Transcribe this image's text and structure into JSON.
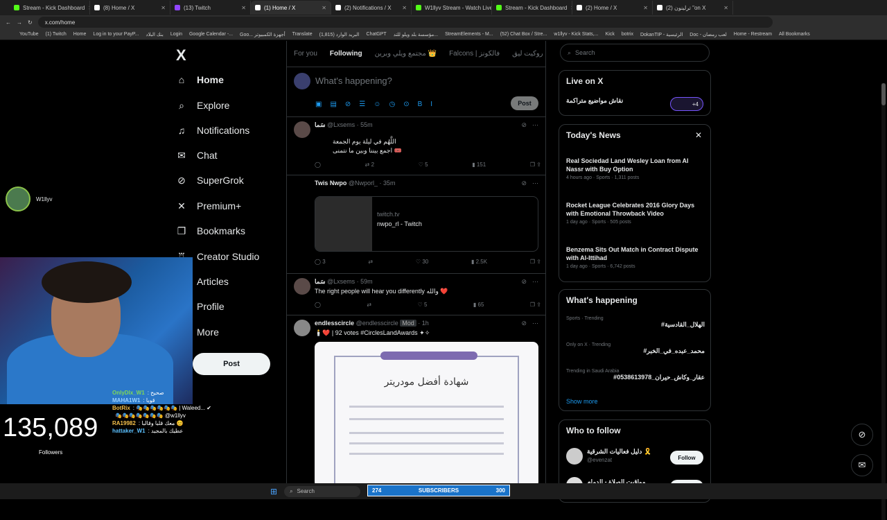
{
  "browser": {
    "tabs": [
      {
        "label": "Stream - Kick Dashboard",
        "color": "#53fc18"
      },
      {
        "label": "(8) Home / X",
        "color": "#ffffff"
      },
      {
        "label": "(13) Twitch",
        "color": "#9146ff"
      },
      {
        "label": "(1) Home / X",
        "color": "#ffffff"
      },
      {
        "label": "(2) Notifications / X",
        "color": "#ffffff"
      },
      {
        "label": "W1llyv Stream - Watch Live o",
        "color": "#53fc18"
      },
      {
        "label": "Stream - Kick Dashboard",
        "color": "#53fc18"
      },
      {
        "label": "(2) Home / X",
        "color": "#ffffff"
      },
      {
        "label": "(2) ترلينون \"on X",
        "color": "#ffffff"
      }
    ],
    "active_tab": 3,
    "url": "x.com/home",
    "bookmarks": [
      "YouTube",
      "(1) Twitch",
      "Home",
      "Log in to your PayP...",
      "بنك البلاد",
      "Login",
      "Google Calendar -...",
      "Goo... أجهزة الكمبيوتر",
      "Translate",
      "البريد الوارد (1,815)",
      "ChatGPT",
      "مؤسسة بلد ويلو للتد...",
      "StreamElements - M...",
      "(52) Chat Box / Stre...",
      "w1llyv - Kick Stats,...",
      "Kick",
      "botrix",
      "DokanTIP - الرئيسية",
      "Doc - لعب رمضان",
      "Home - Restream",
      "All Bookmarks"
    ]
  },
  "nav": {
    "logo": "X",
    "items": [
      {
        "label": "Home",
        "icon": "home-icon",
        "glyph": "⌂"
      },
      {
        "label": "Explore",
        "icon": "search-icon",
        "glyph": "⌕"
      },
      {
        "label": "Notifications",
        "icon": "bell-icon",
        "glyph": "♫"
      },
      {
        "label": "Chat",
        "icon": "mail-icon",
        "glyph": "✉"
      },
      {
        "label": "SuperGrok",
        "icon": "grok-icon",
        "glyph": "⊘"
      },
      {
        "label": "Premium+",
        "icon": "x-premium-icon",
        "glyph": "✕"
      },
      {
        "label": "Bookmarks",
        "icon": "bookmark-icon",
        "glyph": "❐"
      },
      {
        "label": "Creator Studio",
        "icon": "creator-icon",
        "glyph": "♖"
      },
      {
        "label": "Articles",
        "icon": "articles-icon",
        "glyph": "▤"
      },
      {
        "label": "Profile",
        "icon": "profile-icon",
        "glyph": "☺"
      },
      {
        "label": "More",
        "icon": "more-icon",
        "glyph": "⋯"
      }
    ],
    "post_label": "Post"
  },
  "feed": {
    "tabs": [
      "For you",
      "Following",
      "مجتمع ويلي وبرين 👑",
      "Falcons | فالكونز",
      "روكيت ليق"
    ],
    "compose_placeholder": "What's happening?",
    "compose_post": "Post",
    "tweets": [
      {
        "name": "سَما",
        "handle": "@Lxsems",
        "time": "55m",
        "text1": "اللَّهُم في ليلة يوم الجمعة",
        "text2": "اجمع بيننا وبين ما نتمنى 🎟️",
        "replies": "",
        "retweets": "2",
        "likes": "5",
        "views": "151"
      },
      {
        "name": "Twis Nwpo",
        "handle": "@Nwporl_",
        "time": "35m",
        "card_domain": "twitch.tv",
        "card_title": "nwpo_rl - Twitch",
        "replies": "3",
        "retweets": "",
        "likes": "30",
        "views": "2.5K"
      },
      {
        "name": "سَما",
        "handle": "@Lxsems",
        "time": "59m",
        "text1": "The right people will hear you differently والله ❤️",
        "replies": "",
        "retweets": "",
        "likes": "5",
        "views": "65"
      },
      {
        "name": "endlesscircle",
        "handle": "@endlesscircle",
        "badge": "Mod",
        "time": "1h",
        "text1": "🕯️❤️ | 92 votes #CirclesLandAwards ✦✧",
        "cert_title": "شهادة أفضل مودريتر"
      }
    ]
  },
  "right": {
    "search_placeholder": "Search",
    "live_title": "Live on X",
    "live_item": "نقاش مواضيع متراكمة",
    "live_count": "+4",
    "news_title": "Today's News",
    "news": [
      {
        "title": "Real Sociedad Land Wesley Loan from Al Nassr with Buy Option",
        "meta": "4 hours ago · Sports · 1,311 posts"
      },
      {
        "title": "Rocket League Celebrates 2016 Glory Days with Emotional Throwback Video",
        "meta": "1 day ago · Sports · 505 posts"
      },
      {
        "title": "Benzema Sits Out Match in Contract Dispute with Al-Ittihad",
        "meta": "1 day ago · Sports · 6,742 posts"
      }
    ],
    "happening_title": "What's happening",
    "trends": [
      {
        "context": "Sports · Trending",
        "name": "#الهلال_القادسية"
      },
      {
        "context": "Only on X · Trending",
        "name": "#محمد_عبده_في_الخبر"
      },
      {
        "context": "Trending in Saudi Arabia",
        "name": "#عقار_وكاش_حيران_0538613978"
      }
    ],
    "show_more": "Show more",
    "who_title": "Who to follow",
    "follow": [
      {
        "name": "دليل فعاليات الشرقية 🎗️",
        "handle": "@evenzat",
        "btn": "Follow"
      },
      {
        "name": "مواقيت الصلاة - الدمام",
        "handle": "",
        "btn": "Follow"
      }
    ]
  },
  "overlay": {
    "streamer": "W1llyv",
    "viewers": "135,089",
    "followers_label": "Followers",
    "chat": [
      {
        "user": "OnlyDlx_W1",
        "color": "#7fd858",
        "msg": ": صحيح"
      },
      {
        "user": "MAHA1W1",
        "color": "#9ad0ff",
        "msg": ": قوبا"
      },
      {
        "user": "BotRix",
        "color": "#f6c14b",
        "msg": ": 🎭🎭🎭🎭🎭🎭 | Waleed... ✔"
      },
      {
        "user": "",
        "color": "#ccc",
        "msg": "🎭🎭🎭🎭🎭🎭🎭 @w1llyv"
      },
      {
        "user": "RA19982",
        "color": "#f6c14b",
        "msg": ": معك قلبا وقالبا 😊"
      },
      {
        "user": "hattaker_W1",
        "color": "#5bc0ff",
        "msg": ": عطيك بالمجيد"
      }
    ],
    "subs_count": "274",
    "subs_label": "SUBSCRIBERS",
    "subs_goal": "300"
  },
  "taskbar": {
    "search": "Search"
  }
}
